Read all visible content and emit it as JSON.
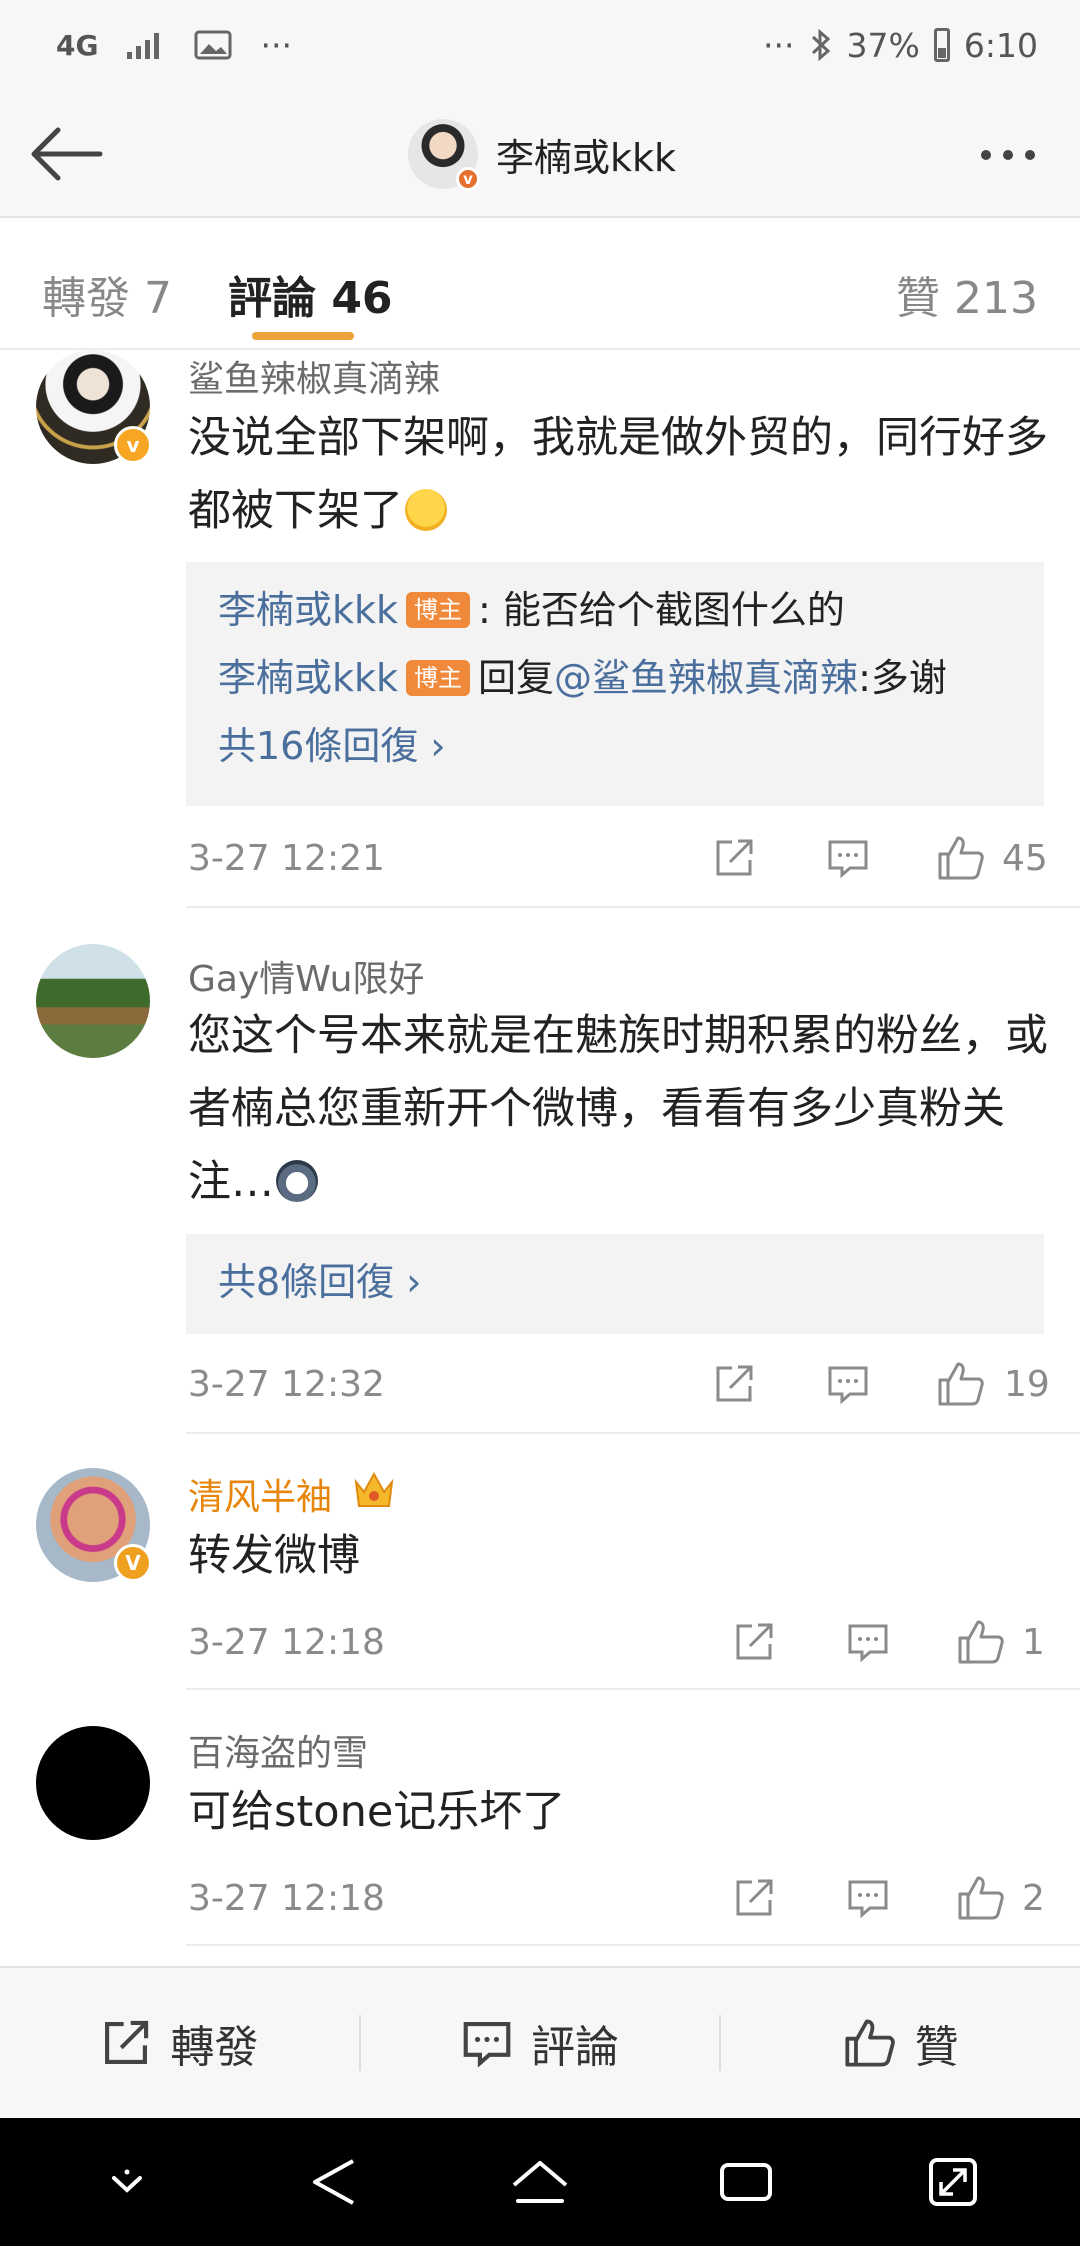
{
  "status_bar": {
    "network": "4G",
    "dots": "···",
    "dots_right": "···",
    "battery": "37%",
    "time": "6:10"
  },
  "header": {
    "title": "李楠或kkk"
  },
  "tabs": [
    {
      "label": "轉發 7"
    },
    {
      "label": "評論 46"
    },
    {
      "label": "贊 213"
    }
  ],
  "comments": [
    {
      "username": "鲨鱼辣椒真滴辣",
      "text": "没说全部下架啊，我就是做外贸的，同行好多都被下架了",
      "replies": [
        {
          "name": "李楠或kkk",
          "tag": "博主",
          "text": ": 能否给个截图什么的"
        },
        {
          "name": "李楠或kkk",
          "tag": "博主",
          "prefix": "回复",
          "mention": "@鲨鱼辣椒真滴辣",
          "text": ":多谢"
        }
      ],
      "more_replies": "共16條回復 ›",
      "time": "3-27 12:21",
      "likes": "45"
    },
    {
      "username": "Gay情Wu限好",
      "text": "您这个号本来就是在魅族时期积累的粉丝，或者楠总您重新开个微博，看看有多少真粉关注…",
      "more_replies": "共8條回復 ›",
      "time": "3-27 12:32",
      "likes": "19"
    },
    {
      "username": "清风半袖",
      "text": "转发微博",
      "time": "3-27 12:18",
      "likes": "1"
    },
    {
      "username": "百海盗的雪",
      "text": "可给stone记乐坏了",
      "time": "3-27 12:18",
      "likes": "2"
    }
  ],
  "bottom_bar": {
    "repost": "轉發",
    "comment": "評論",
    "like": "贊"
  },
  "colors": {
    "accent": "#f0a23a",
    "link": "#4a6f9c",
    "vip_name": "#e8860c",
    "host_tag": "#f08a3a"
  }
}
